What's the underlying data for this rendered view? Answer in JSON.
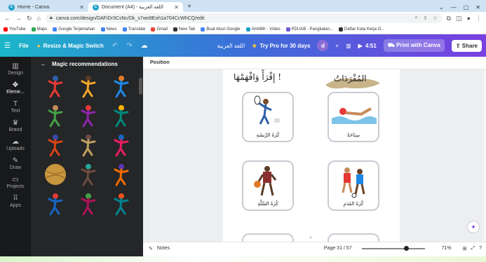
{
  "browser": {
    "tabs": [
      {
        "title": "Home - Canva",
        "active": false
      },
      {
        "title": "Document (A4) - اللغة العربية",
        "active": true
      }
    ],
    "new_tab": "+",
    "url": "canva.com/design/DAFiDr3CsNc/Dk_s7wo9Eoh1a704CcWhCQ/edit",
    "bookmarks": [
      {
        "label": "YouTube",
        "color": "#ff0000"
      },
      {
        "label": "Maps",
        "color": "#34a853"
      },
      {
        "label": "Google Terjemahan",
        "color": "#4285f4"
      },
      {
        "label": "News",
        "color": "#4285f4"
      },
      {
        "label": "Translate",
        "color": "#4285f4"
      },
      {
        "label": "Gmail",
        "color": "#ea4335"
      },
      {
        "label": "New Tab",
        "color": "#333333"
      },
      {
        "label": "Buat Akun Google",
        "color": "#4285f4"
      },
      {
        "label": "AHABK - Video",
        "color": "#1aa0c8"
      },
      {
        "label": "PDUAB - Pangkalan...",
        "color": "#6a5acd"
      },
      {
        "label": "Daftar Kata Kerja O...",
        "color": "#333333"
      }
    ]
  },
  "canva_top": {
    "file": "File",
    "resize": "Resize & Magic Switch",
    "doc_title": "اللغة العربية",
    "try_pro": "Try Pro for 30 days",
    "avatar": "d",
    "timer": "4:51",
    "print": "Print with Canva",
    "share": "Share"
  },
  "left_nav": [
    {
      "label": "Design",
      "icon": "layout-icon",
      "glyph": "▥"
    },
    {
      "label": "Eleme...",
      "icon": "elements-icon",
      "glyph": "✥",
      "active": true
    },
    {
      "label": "Text",
      "icon": "text-icon",
      "glyph": "T"
    },
    {
      "label": "Brand",
      "icon": "brand-icon",
      "glyph": "♛"
    },
    {
      "label": "Uploads",
      "icon": "upload-icon",
      "glyph": "☁"
    },
    {
      "label": "Draw",
      "icon": "draw-icon",
      "glyph": "✎"
    },
    {
      "label": "Projects",
      "icon": "folder-icon",
      "glyph": "▭"
    },
    {
      "label": "Apps",
      "icon": "apps-icon",
      "glyph": "⠿"
    }
  ],
  "panel": {
    "title": "Magic recommendations"
  },
  "toolbar": {
    "position": "Position"
  },
  "page": {
    "heading_right": "المُفْرَدَاتُ",
    "heading_left": "إِقْرَأْ وَافْهَمْهَا !",
    "cards": [
      {
        "caption": "كُرَةُ الرِّيشَةِ"
      },
      {
        "caption": "سِبَاحَةٌ"
      },
      {
        "caption": "كُرَةُ السَّلَّةِ"
      },
      {
        "caption": "كُرَةُ القَدَمِ"
      }
    ]
  },
  "status": {
    "notes": "Notes",
    "page_indicator": "Page 31 / 57",
    "zoom": "71%",
    "zoom_fraction": 0.71
  }
}
